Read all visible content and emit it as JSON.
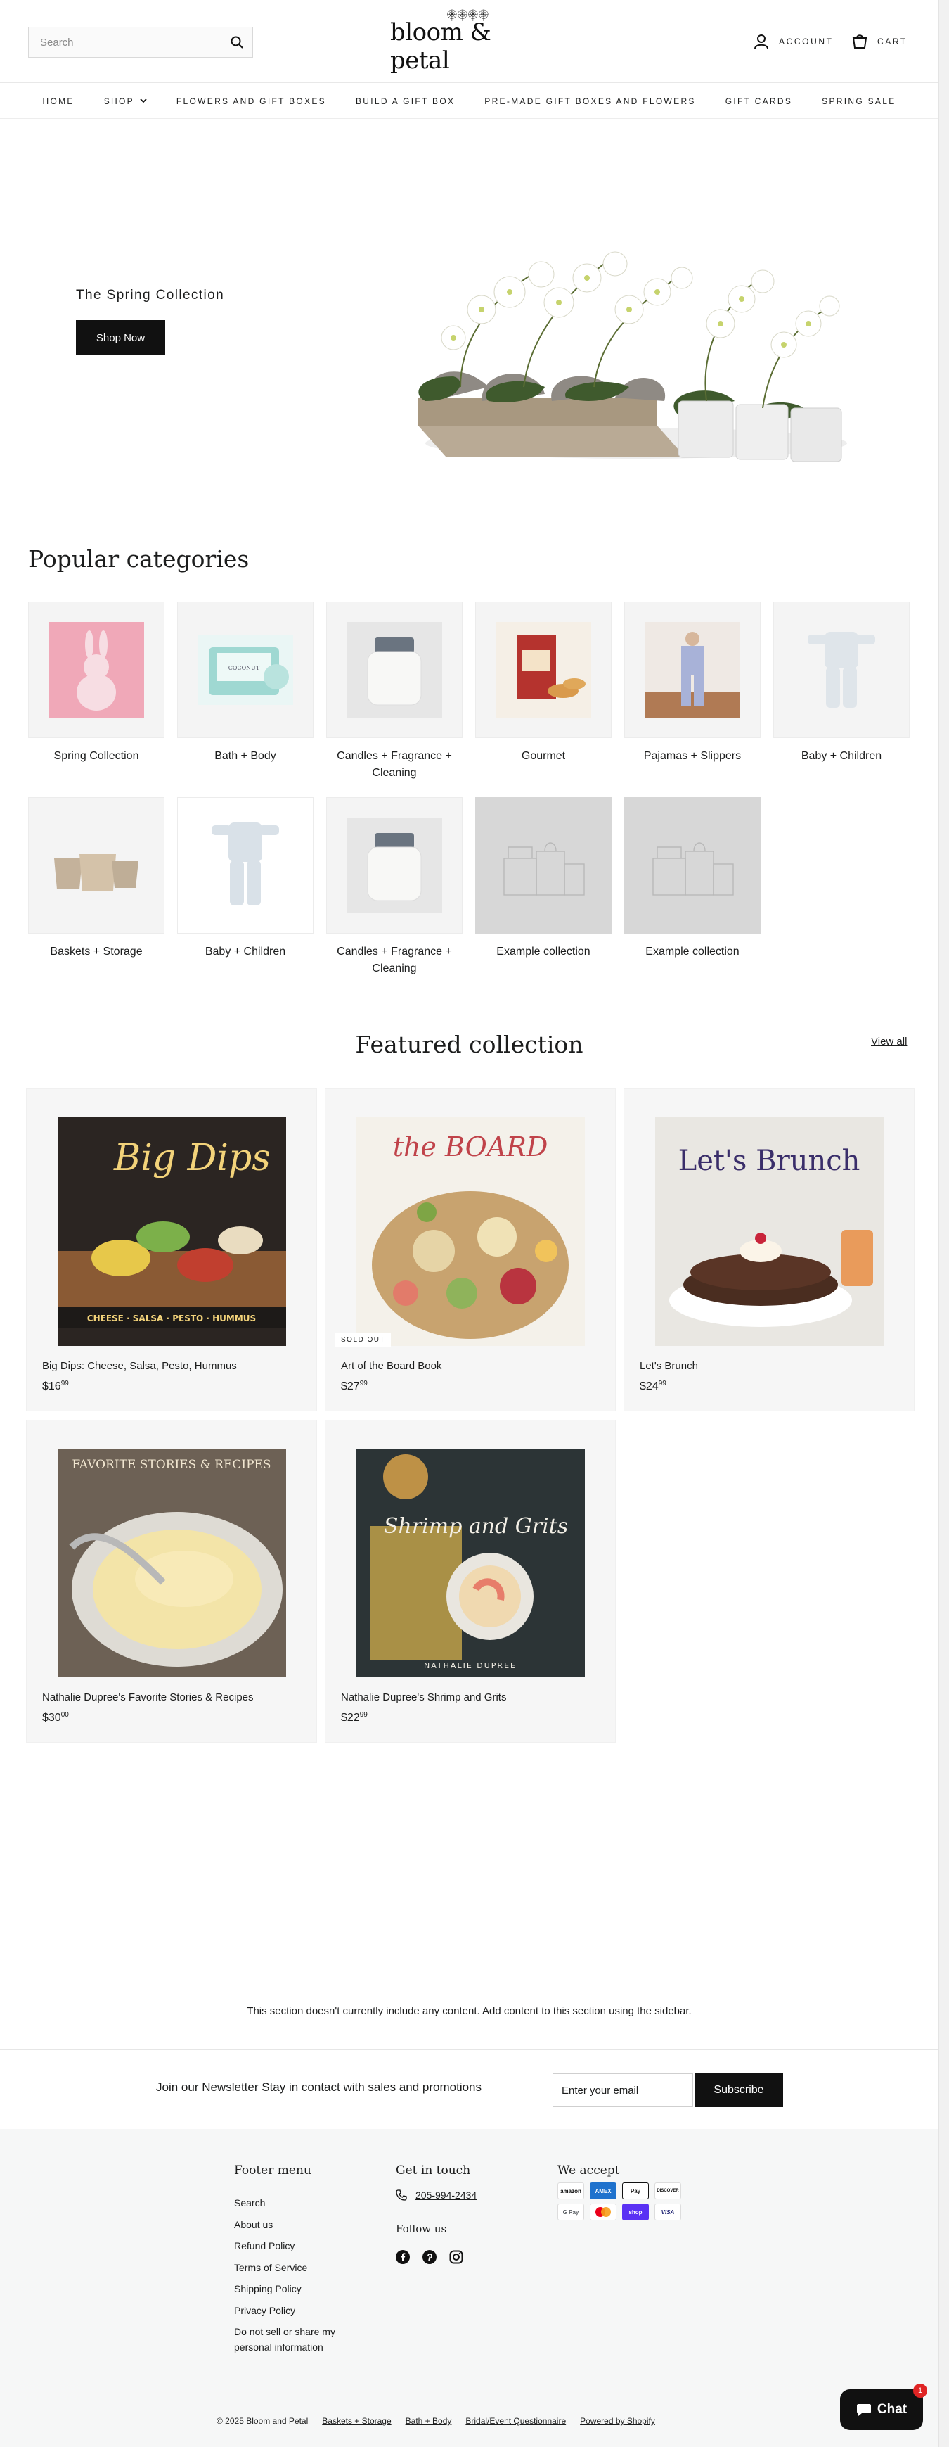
{
  "header": {
    "search_placeholder": "Search",
    "logo_text": "bloom & petal",
    "account_label": "ACCOUNT",
    "cart_label": "CART"
  },
  "nav": {
    "items": [
      "HOME",
      "SHOP",
      "FLOWERS AND GIFT BOXES",
      "BUILD A GIFT BOX",
      "PRE-MADE GIFT BOXES AND FLOWERS",
      "GIFT CARDS",
      "SPRING SALE"
    ]
  },
  "hero": {
    "title": "The Spring Collection",
    "button_label": "Shop Now"
  },
  "categories": {
    "title": "Popular categories",
    "items": [
      {
        "label": "Spring Collection"
      },
      {
        "label": "Bath + Body"
      },
      {
        "label": "Candles + Fragrance + Cleaning"
      },
      {
        "label": "Gourmet"
      },
      {
        "label": "Pajamas + Slippers"
      },
      {
        "label": "Baby + Children"
      },
      {
        "label": "Baskets + Storage"
      },
      {
        "label": "Baby + Children"
      },
      {
        "label": "Candles + Fragrance + Cleaning"
      },
      {
        "label": "Example collection"
      },
      {
        "label": "Example collection"
      }
    ]
  },
  "featured": {
    "title": "Featured collection",
    "view_all": "View all",
    "products": [
      {
        "name": "Big Dips: Cheese, Salsa, Pesto, Hummus",
        "price_main": "$16",
        "price_cents": "99",
        "badge": "",
        "cover_title": "Big Dips",
        "cover_sub": "CHEESE · SALSA · PESTO · HUMMUS"
      },
      {
        "name": "Art of the Board Book",
        "price_main": "$27",
        "price_cents": "99",
        "badge": "SOLD OUT",
        "cover_title": "the BOARD",
        "cover_sub": ""
      },
      {
        "name": "Let's Brunch",
        "price_main": "$24",
        "price_cents": "99",
        "badge": "",
        "cover_title": "Let's Brunch",
        "cover_sub": ""
      },
      {
        "name": "Nathalie Dupree's Favorite Stories & Recipes",
        "price_main": "$30",
        "price_cents": "00",
        "badge": "",
        "cover_title": "FAVORITE STORIES & RECIPES",
        "cover_sub": ""
      },
      {
        "name": "Nathalie Dupree's Shrimp and Grits",
        "price_main": "$22",
        "price_cents": "99",
        "badge": "",
        "cover_title": "Shrimp and Grits",
        "cover_sub": "NATHALIE DUPREE"
      }
    ]
  },
  "empty_section": {
    "message": "This section doesn't currently include any content. Add content to this section using the sidebar."
  },
  "newsletter": {
    "text": "Join our Newsletter Stay in contact with sales and promotions",
    "placeholder": "Enter your email",
    "button": "Subscribe"
  },
  "footer": {
    "menu_title": "Footer menu",
    "menu_items": [
      "Search",
      "About us",
      "Refund Policy",
      "Terms of Service",
      "Shipping Policy",
      "Privacy Policy",
      "Do not sell or share my personal information"
    ],
    "contact_title": "Get in touch",
    "phone": "205-994-2434",
    "follow_title": "Follow us",
    "accept_title": "We accept",
    "payments": [
      "amazon",
      "AMEX",
      "Pay",
      "DISCOVER",
      "G Pay",
      "mastercard",
      "shop",
      "VISA"
    ],
    "copyright": "© 2025 Bloom and Petal",
    "bottom_links": [
      "Baskets + Storage",
      "Bath + Body",
      "Bridal/Event Questionnaire",
      "Powered by Shopify"
    ]
  },
  "chat": {
    "label": "Chat",
    "badge": "1"
  },
  "colors": {
    "black": "#111111",
    "text": "#1c1d1d",
    "card_bg": "#f6f6f6",
    "footer_bg": "#f6f7f7",
    "placeholder_bg": "#d7d7d7"
  }
}
